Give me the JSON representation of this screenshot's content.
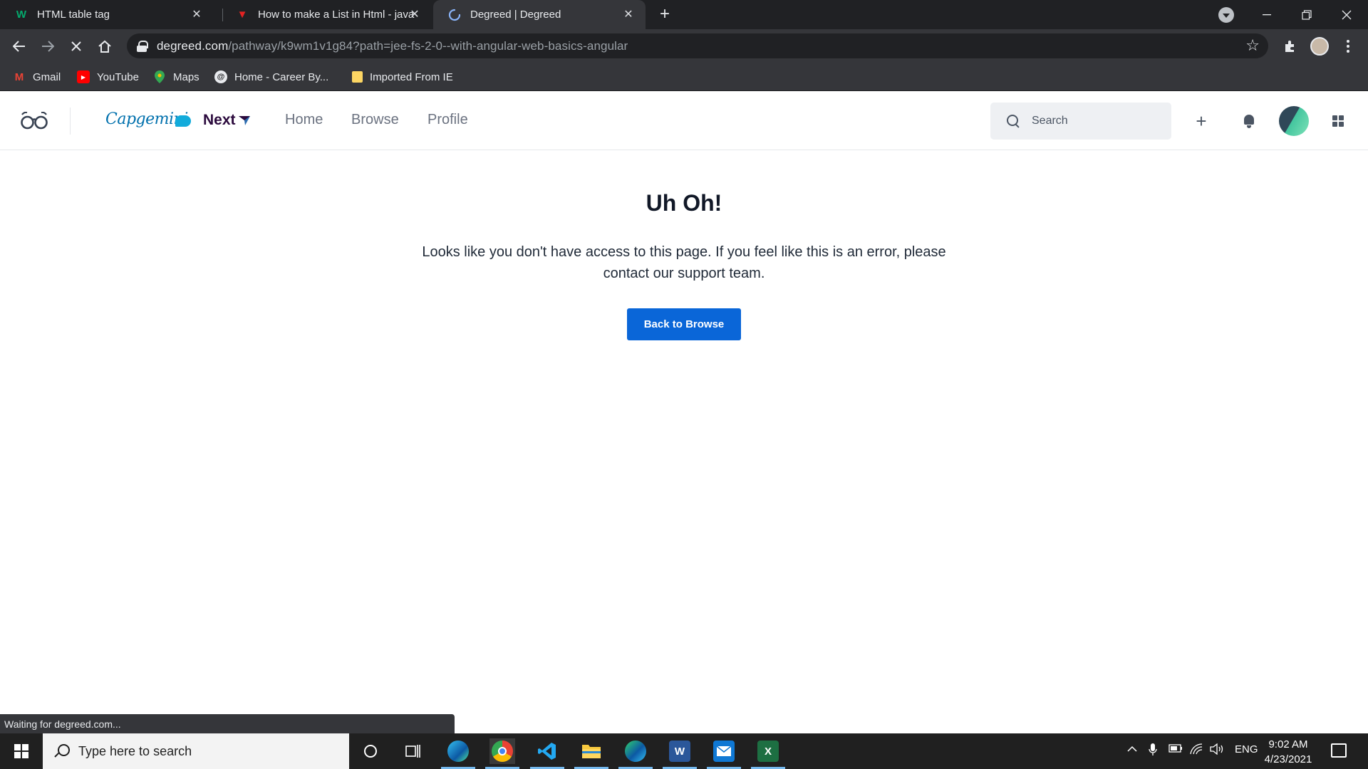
{
  "browser": {
    "tabs": [
      {
        "title": "HTML table tag",
        "favicon": "w3schools-icon",
        "active": false
      },
      {
        "title": "How to make a List in Html - java",
        "favicon": "javatpoint-icon",
        "active": false
      },
      {
        "title": "Degreed | Degreed",
        "favicon": "loading-icon",
        "active": true
      }
    ],
    "close_glyph": "✕",
    "new_tab_glyph": "+",
    "url_host": "degreed.com",
    "url_path": "/pathway/k9wm1v1g84?path=jee-fs-2-0--with-angular-web-basics-angular",
    "bookmarks": [
      {
        "label": "Gmail",
        "icon": "gmail-icon",
        "color": "#ea4335",
        "glyph": "M"
      },
      {
        "label": "YouTube",
        "icon": "youtube-icon",
        "color": "#ff0000",
        "glyph": "▶"
      },
      {
        "label": "Maps",
        "icon": "maps-icon",
        "color": "#34a853",
        "glyph": "●"
      },
      {
        "label": "Home - Career By...",
        "icon": "career-icon",
        "color": "#e8eaed",
        "glyph": "@"
      },
      {
        "label": "Imported From IE",
        "icon": "folder-icon",
        "color": "#fdd663",
        "glyph": ""
      }
    ],
    "status_text": "Waiting for degreed.com..."
  },
  "app": {
    "brand_capgemini": "Capgemini",
    "brand_next": "Next",
    "nav": [
      "Home",
      "Browse",
      "Profile"
    ],
    "search_placeholder": "Search",
    "add_glyph": "+"
  },
  "main": {
    "title": "Uh Oh!",
    "message": "Looks like you don't have access to this page. If you feel like this is an error, please contact our support team.",
    "button_label": "Back to Browse",
    "button_color": "#0a66d8"
  },
  "taskbar": {
    "search_placeholder": "Type here to search",
    "language": "ENG",
    "time": "9:02 AM",
    "date": "4/23/2021",
    "apps": [
      "edge-icon",
      "chrome-icon",
      "vscode-icon",
      "file-explorer-icon",
      "edge-dev-icon",
      "word-icon",
      "outlook-icon",
      "excel-icon"
    ]
  }
}
